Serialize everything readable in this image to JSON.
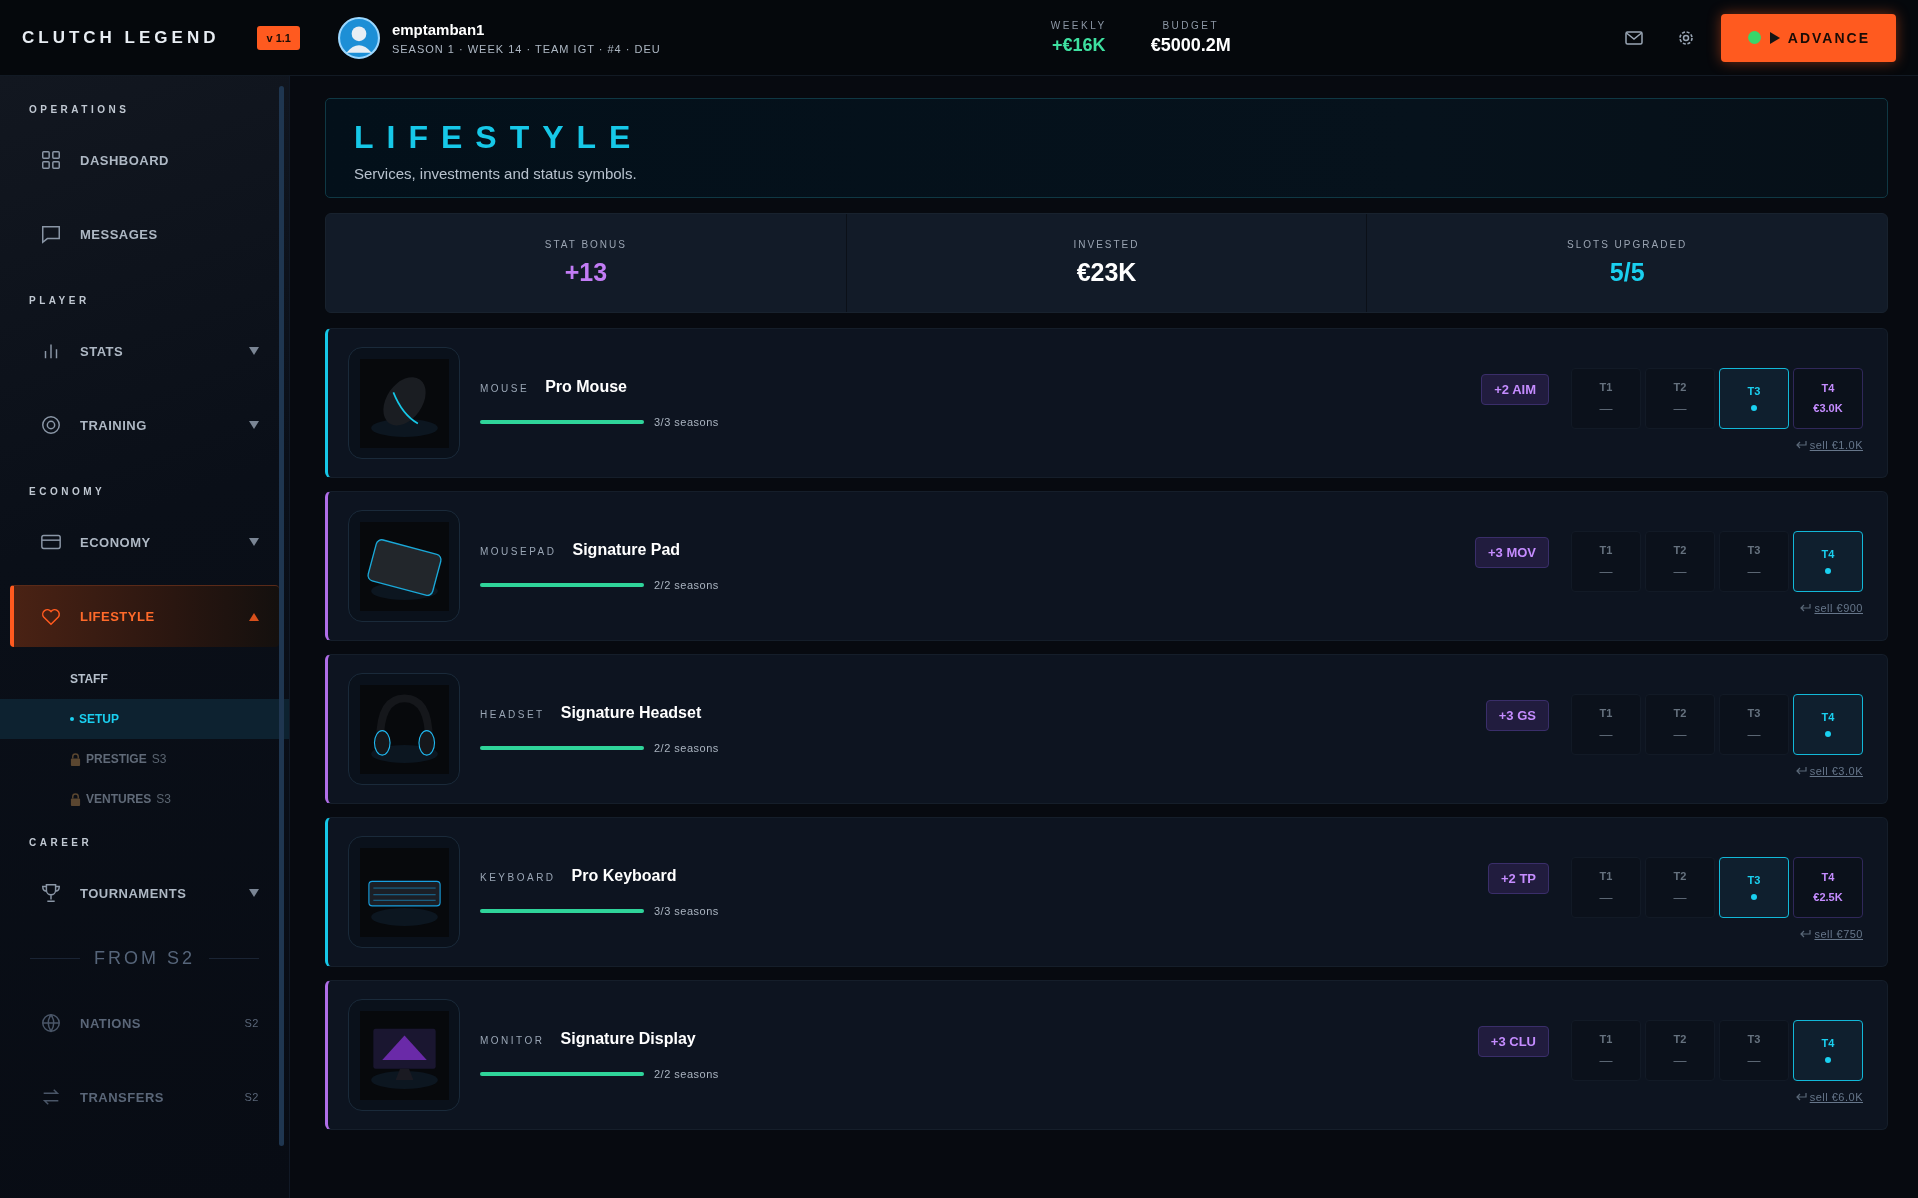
{
  "app": {
    "logo": "CLUTCH LEGEND",
    "version": "v 1.1"
  },
  "player": {
    "name": "emptamban1",
    "subtitle": "SEASON 1 · WEEK 14 · TEAM IGT · #4 · DEU"
  },
  "finance": [
    {
      "label": "WEEKLY",
      "value": "+€16K",
      "color": "#3ee0a0"
    },
    {
      "label": "BUDGET",
      "value": "€5000.2M",
      "color": "#ffffff"
    }
  ],
  "advance": {
    "label": "ADVANCE"
  },
  "sidebar": {
    "sections": [
      {
        "title": "OPERATIONS",
        "items": [
          {
            "kind": "link",
            "label": "DASHBOARD",
            "selected": false
          },
          {
            "kind": "link",
            "label": "MESSAGES",
            "selected": false
          }
        ]
      },
      {
        "title": "PLAYER",
        "items": [
          {
            "kind": "link",
            "label": "STATS",
            "selected": false,
            "expanded": false
          },
          {
            "kind": "link",
            "label": "TRAINING",
            "selected": false,
            "expanded": false
          }
        ]
      },
      {
        "title": "ECONOMY",
        "items": [
          {
            "kind": "link",
            "label": "ECONOMY",
            "selected": false,
            "expanded": false
          },
          {
            "kind": "link",
            "label": "LIFESTYLE",
            "selected": true,
            "expanded": true,
            "children": [
              {
                "label": "STAFF",
                "selected": false,
                "locked": false
              },
              {
                "label": "SETUP",
                "selected": true,
                "locked": false
              },
              {
                "label": "PRESTIGE",
                "selected": false,
                "locked": true,
                "badge": "S3"
              },
              {
                "label": "VENTURES",
                "selected": false,
                "locked": true,
                "badge": "S3"
              }
            ]
          }
        ]
      },
      {
        "title": "CAREER",
        "items": [
          {
            "kind": "link",
            "label": "TOURNAMENTS",
            "selected": false,
            "expanded": false
          },
          {
            "kind": "divider",
            "label": "FROM S2"
          },
          {
            "kind": "link",
            "label": "NATIONS",
            "selected": false,
            "disabled": true,
            "badge": "S2"
          },
          {
            "kind": "link",
            "label": "TRANSFERS",
            "selected": false,
            "disabled": true,
            "badge": "S2"
          }
        ]
      }
    ]
  },
  "page": {
    "title": "LIFESTYLE",
    "subtitle": "Services, investments and status symbols."
  },
  "stats": [
    {
      "label": "STAT BONUS",
      "value": "+13",
      "color": "#c27cf5"
    },
    {
      "label": "INVESTED",
      "value": "€23K",
      "color": "#ffffff"
    },
    {
      "label": "SLOTS UPGRADED",
      "value": "5/5",
      "color": "#1ad0f0"
    }
  ],
  "items": [
    {
      "category": "MOUSE",
      "name": "Pro Mouse",
      "color": "#16c8e8",
      "level": 1,
      "progress": "3/3 seasons",
      "bonus": "+2 AIM",
      "sell": "sell €1.0K",
      "tiers": [
        {
          "label": "T1",
          "kind": "empty",
          "value": "—"
        },
        {
          "label": "T2",
          "kind": "empty",
          "value": "—"
        },
        {
          "label": "T3",
          "kind": "current"
        },
        {
          "label": "T4",
          "kind": "buy",
          "value": "€3.0K"
        }
      ]
    },
    {
      "category": "MOUSEPAD",
      "name": "Signature Pad",
      "color": "#b06ee8",
      "level": 1,
      "progress": "2/2 seasons",
      "bonus": "+3 MOV",
      "sell": "sell €900",
      "tiers": [
        {
          "label": "T1",
          "kind": "empty",
          "value": "—"
        },
        {
          "label": "T2",
          "kind": "empty",
          "value": "—"
        },
        {
          "label": "T3",
          "kind": "empty",
          "value": "—"
        },
        {
          "label": "T4",
          "kind": "current"
        }
      ]
    },
    {
      "category": "HEADSET",
      "name": "Signature Headset",
      "color": "#b06ee8",
      "level": 1,
      "progress": "2/2 seasons",
      "bonus": "+3 GS",
      "sell": "sell €3.0K",
      "tiers": [
        {
          "label": "T1",
          "kind": "empty",
          "value": "—"
        },
        {
          "label": "T2",
          "kind": "empty",
          "value": "—"
        },
        {
          "label": "T3",
          "kind": "empty",
          "value": "—"
        },
        {
          "label": "T4",
          "kind": "current"
        }
      ]
    },
    {
      "category": "KEYBOARD",
      "name": "Pro Keyboard",
      "color": "#16c8e8",
      "level": 1,
      "progress": "3/3 seasons",
      "bonus": "+2 TP",
      "sell": "sell €750",
      "tiers": [
        {
          "label": "T1",
          "kind": "empty",
          "value": "—"
        },
        {
          "label": "T2",
          "kind": "empty",
          "value": "—"
        },
        {
          "label": "T3",
          "kind": "current"
        },
        {
          "label": "T4",
          "kind": "buy",
          "value": "€2.5K"
        }
      ]
    },
    {
      "category": "MONITOR",
      "name": "Signature Display",
      "color": "#b06ee8",
      "level": 1,
      "progress": "2/2 seasons",
      "bonus": "+3 CLU",
      "sell": "sell €6.0K",
      "tiers": [
        {
          "label": "T1",
          "kind": "empty",
          "value": "—"
        },
        {
          "label": "T2",
          "kind": "empty",
          "value": "—"
        },
        {
          "label": "T3",
          "kind": "empty",
          "value": "—"
        },
        {
          "label": "T4",
          "kind": "current"
        }
      ]
    }
  ]
}
